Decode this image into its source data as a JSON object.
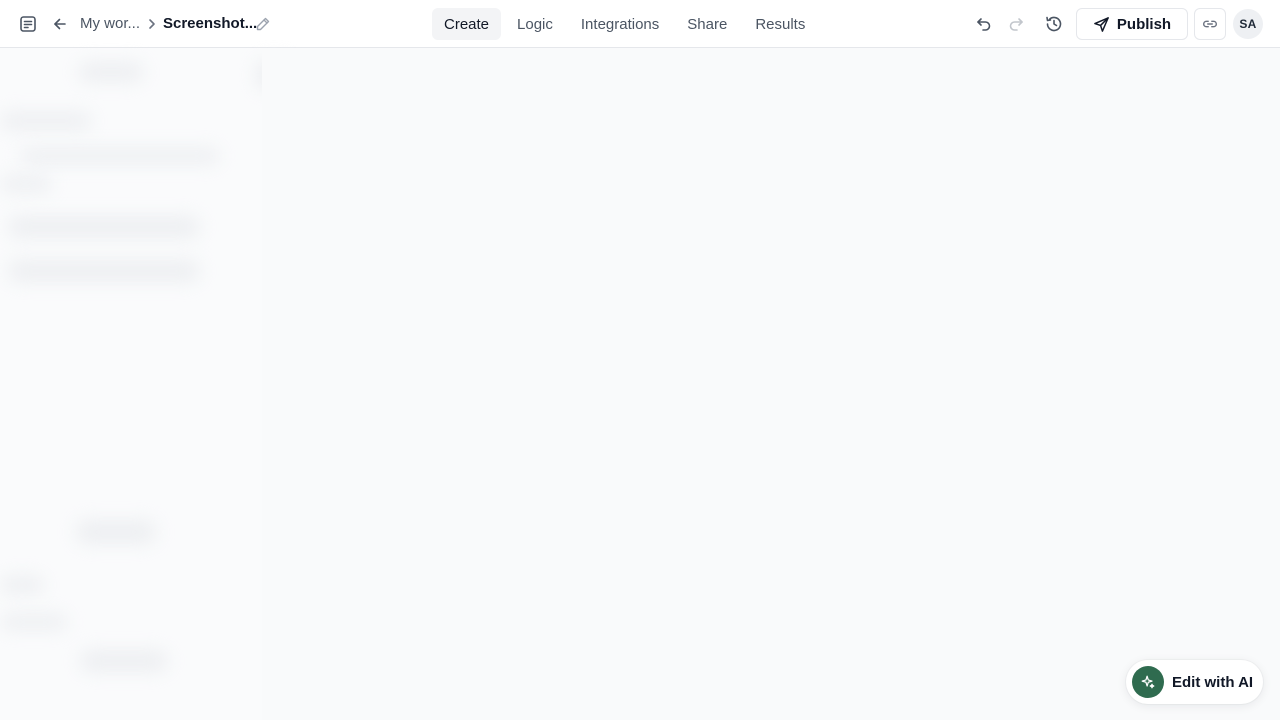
{
  "header": {
    "breadcrumb_parent": "My wor...",
    "breadcrumb_current": "Screenshot...",
    "tabs": [
      {
        "label": "Create",
        "active": true
      },
      {
        "label": "Logic",
        "active": false
      },
      {
        "label": "Integrations",
        "active": false
      },
      {
        "label": "Share",
        "active": false
      },
      {
        "label": "Results",
        "active": false
      }
    ],
    "publish_label": "Publish",
    "avatar_initials": "SA"
  },
  "icons": {
    "app": "form-icon",
    "back": "arrow-left-icon",
    "separator": "chevron-right-icon",
    "rename": "pencil-icon",
    "undo": "undo-icon",
    "redo": "redo-icon",
    "history": "history-icon",
    "publish": "send-icon",
    "copy_link": "link-icon",
    "ai": "sparkle-icon"
  },
  "ai_button": {
    "label": "Edit with AI"
  },
  "colors": {
    "accent": "#2f6b4f",
    "background": "#f9fafb",
    "topbar": "#ffffff",
    "border": "#e5e7eb"
  }
}
